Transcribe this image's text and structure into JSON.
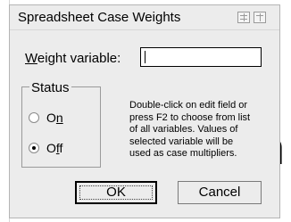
{
  "dialog": {
    "title": "Spreadsheet Case Weights",
    "titlebar_icons": [
      "window-menu-icon",
      "maximize-icon"
    ]
  },
  "weight": {
    "label_accel": "W",
    "label_rest": "eight variable:",
    "value": ""
  },
  "status": {
    "legend": "Status",
    "options": [
      {
        "label_pre": "O",
        "label_accel": "n",
        "label_post": "",
        "selected": false
      },
      {
        "label_pre": "O",
        "label_accel": "f",
        "label_post": "f",
        "selected": true
      }
    ]
  },
  "hint": {
    "lines": [
      "Double-click on edit field or",
      "press F2 to choose from list",
      "of all variables. Values of",
      "selected variable will be",
      "used as case multipliers."
    ]
  },
  "buttons": {
    "ok": "OK",
    "cancel": "Cancel"
  },
  "background": {
    "glyph": "n"
  }
}
